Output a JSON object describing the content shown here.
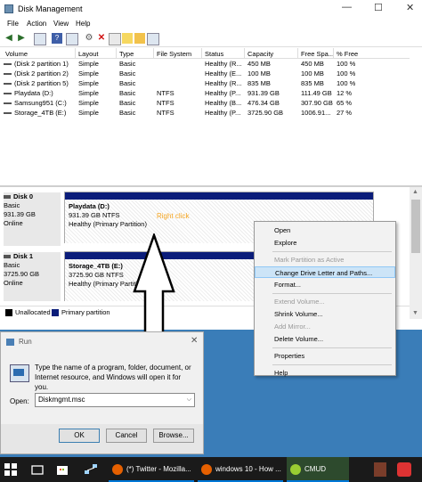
{
  "window": {
    "title": "Disk Management",
    "controls": [
      "—",
      "☐",
      "✕"
    ]
  },
  "menu": [
    "File",
    "Action",
    "View",
    "Help"
  ],
  "toolbar_icons": [
    "back-icon",
    "forward-icon",
    "volume-list-icon",
    "help-icon",
    "graphical-view-icon",
    "connect-icon",
    "delete-icon",
    "properties-icon",
    "new-icon",
    "folder-icon",
    "list-icon"
  ],
  "volume_table": {
    "columns": [
      "Volume",
      "Layout",
      "Type",
      "File System",
      "Status",
      "Capacity",
      "Free Spa...",
      "% Free"
    ],
    "rows": [
      [
        "(Disk 2 partition 1)",
        "Simple",
        "Basic",
        "",
        "Healthy (R...",
        "450 MB",
        "450 MB",
        "100 %"
      ],
      [
        "(Disk 2 partition 2)",
        "Simple",
        "Basic",
        "",
        "Healthy (E...",
        "100 MB",
        "100 MB",
        "100 %"
      ],
      [
        "(Disk 2 partition 5)",
        "Simple",
        "Basic",
        "",
        "Healthy (R...",
        "835 MB",
        "835 MB",
        "100 %"
      ],
      [
        "Playdata (D:)",
        "Simple",
        "Basic",
        "NTFS",
        "Healthy (P...",
        "931.39 GB",
        "111.49 GB",
        "12 %"
      ],
      [
        "Samsung951 (C:)",
        "Simple",
        "Basic",
        "NTFS",
        "Healthy (B...",
        "476.34 GB",
        "307.90 GB",
        "65 %"
      ],
      [
        "Storage_4TB (E:)",
        "Simple",
        "Basic",
        "NTFS",
        "Healthy (P...",
        "3725.90 GB",
        "1006.91...",
        "27 %"
      ]
    ]
  },
  "disks": [
    {
      "name": "Disk 0",
      "type": "Basic",
      "size": "931.39 GB",
      "state": "Online",
      "partition": {
        "title": "Playdata  (D:)",
        "detail": "931.39 GB NTFS",
        "status": "Healthy (Primary Partition)"
      }
    },
    {
      "name": "Disk 1",
      "type": "Basic",
      "size": "3725.90 GB",
      "state": "Online",
      "partition": {
        "title": "Storage_4TB  (E:)",
        "detail": "3725.90 GB NTFS",
        "status": "Healthy (Primary Partition)"
      }
    }
  ],
  "annotation": "Right click",
  "legend": [
    {
      "label": "Unallocated",
      "color": "#000000"
    },
    {
      "label": "Primary partition",
      "color": "#0b1d7a"
    }
  ],
  "context_menu": [
    {
      "label": "Open",
      "enabled": true
    },
    {
      "label": "Explore",
      "enabled": true
    },
    {
      "sep": true
    },
    {
      "label": "Mark Partition as Active",
      "enabled": false
    },
    {
      "label": "Change Drive Letter and Paths...",
      "enabled": true,
      "highlighted": true
    },
    {
      "label": "Format...",
      "enabled": true
    },
    {
      "sep": true
    },
    {
      "label": "Extend Volume...",
      "enabled": false
    },
    {
      "label": "Shrink Volume...",
      "enabled": true
    },
    {
      "label": "Add Mirror...",
      "enabled": false
    },
    {
      "label": "Delete Volume...",
      "enabled": true
    },
    {
      "sep": true
    },
    {
      "label": "Properties",
      "enabled": true
    },
    {
      "sep": true
    },
    {
      "label": "Help",
      "enabled": true
    }
  ],
  "run_dialog": {
    "title": "Run",
    "description": "Type the name of a program, folder, document, or Internet resource, and Windows will open it for you.",
    "open_label": "Open:",
    "open_value": "Diskmgmt.msc",
    "buttons": {
      "ok": "OK",
      "cancel": "Cancel",
      "browse": "Browse..."
    }
  },
  "taskbar": {
    "tasks": [
      {
        "label": "(*) Twitter - Mozilla...",
        "icon": "firefox-icon"
      },
      {
        "label": "windows 10 - How ...",
        "icon": "firefox-icon"
      },
      {
        "label": "CMUD",
        "icon": "cmud-icon"
      }
    ],
    "accent": "#0078d7"
  }
}
